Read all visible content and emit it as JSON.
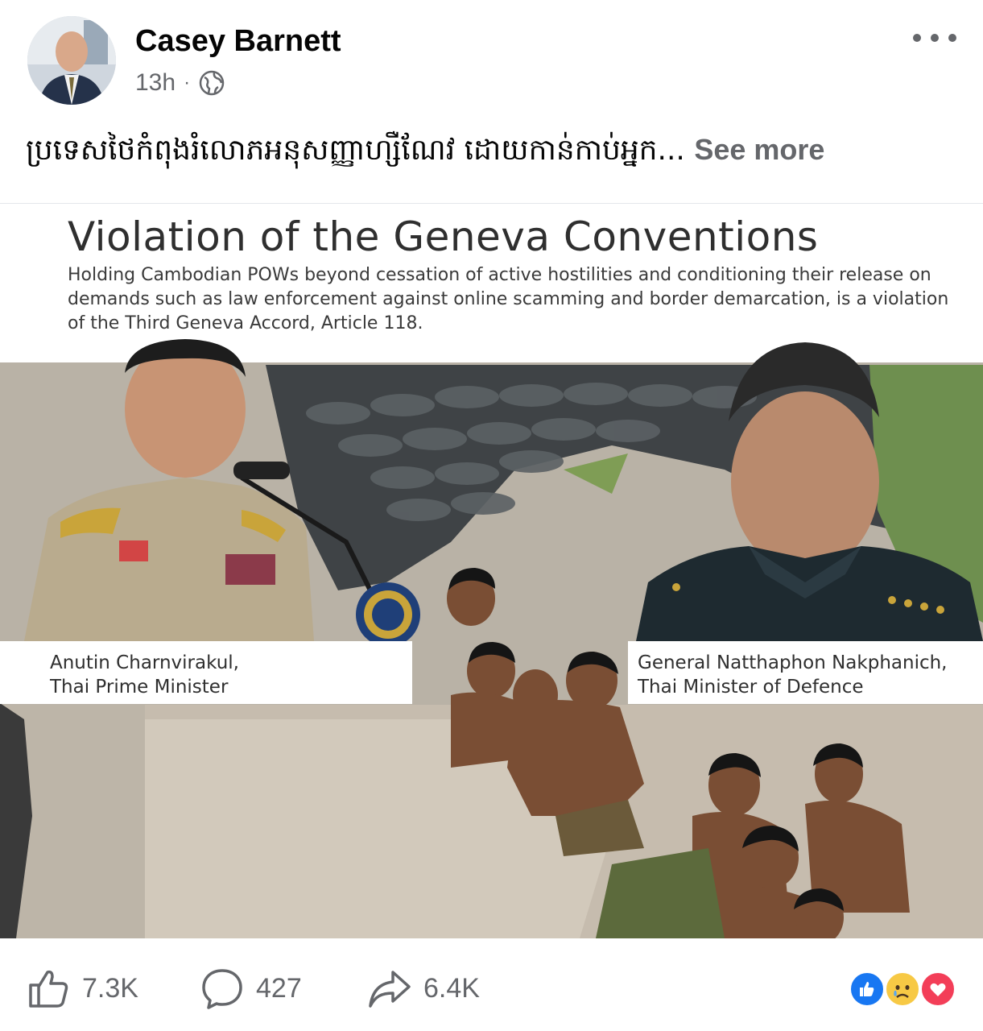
{
  "post": {
    "author": "Casey Barnett",
    "time": "13h",
    "dot": "·",
    "privacy_icon": "globe-icon",
    "text": "ប្រទេសថៃកំពុងរំលោភអនុសញ្ញាហ្សឺណែវ ដោយកាន់កាប់អ្នក...",
    "see_more": "See more"
  },
  "image": {
    "title": "Violation of the Geneva Conventions",
    "subtitle": "Holding Cambodian POWs beyond cessation of active hostilities and conditioning their release on demands such as law enforcement against online scamming and border demarcation, is a violation of the Third Geneva Accord, Article 118.",
    "caption_left": {
      "name": "Anutin Charnvirakul,",
      "role": "Thai Prime Minister"
    },
    "caption_right": {
      "name": "General Natthaphon Nakphanich,",
      "role": "Thai Minister of Defence"
    }
  },
  "actions": {
    "likes": "7.3K",
    "comments": "427",
    "shares": "6.4K"
  },
  "reactions": [
    "like",
    "sad",
    "love"
  ],
  "colors": {
    "brand_blue": "#1877f2",
    "muted_text": "#65676b",
    "love_red": "#f33e58",
    "sad_yellow": "#f7c945"
  }
}
